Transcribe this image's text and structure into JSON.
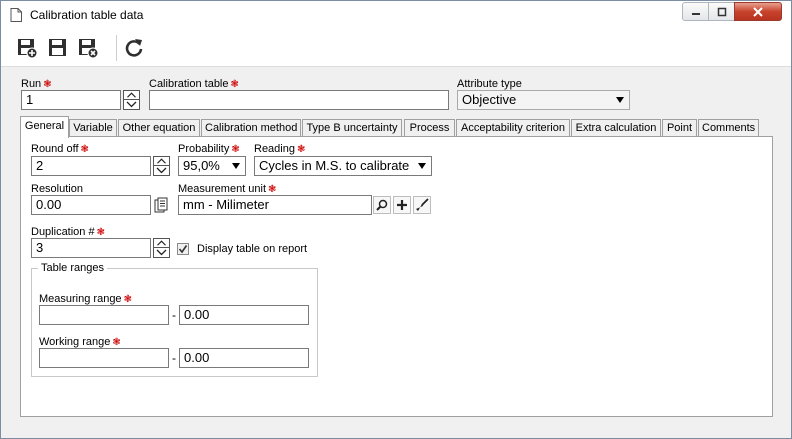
{
  "window": {
    "title": "Calibration table data"
  },
  "toolbar": {
    "buttons": [
      "save-new-icon",
      "save-icon",
      "save-close-icon",
      "refresh-icon"
    ]
  },
  "header": {
    "run_label": "Run",
    "run_value": "1",
    "calibration_table_label": "Calibration table",
    "calibration_table_value": "",
    "attribute_type_label": "Attribute type",
    "attribute_type_value": "Objective"
  },
  "tabs": [
    {
      "label": "General",
      "active": true
    },
    {
      "label": "Variable"
    },
    {
      "label": "Other equation"
    },
    {
      "label": "Calibration method"
    },
    {
      "label": "Type B uncertainty"
    },
    {
      "label": "Process"
    },
    {
      "label": "Acceptability criterion"
    },
    {
      "label": "Extra calculation"
    },
    {
      "label": "Point"
    },
    {
      "label": "Comments"
    }
  ],
  "general": {
    "round_off_label": "Round off",
    "round_off_value": "2",
    "probability_label": "Probability",
    "probability_value": "95,0%",
    "reading_label": "Reading",
    "reading_value": "Cycles in M.S. to calibrate",
    "resolution_label": "Resolution",
    "resolution_value": "0.00",
    "measurement_unit_label": "Measurement unit",
    "measurement_unit_value": "mm - Milimeter",
    "duplication_label": "Duplication #",
    "duplication_value": "3",
    "display_table_label": "Display table on report",
    "display_table_checked": true,
    "table_ranges": {
      "title": "Table ranges",
      "measuring_range_label": "Measuring range",
      "measuring_from": "",
      "measuring_to": "0.00",
      "working_range_label": "Working range",
      "working_from": "",
      "working_to": "0.00",
      "separator": "-"
    }
  },
  "required_marker": "❃"
}
